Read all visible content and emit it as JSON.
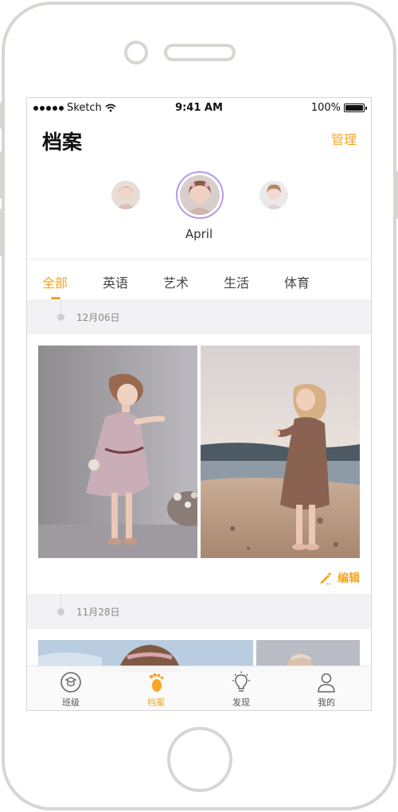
{
  "status_bar": {
    "carrier": "Sketch",
    "time": "9:41 AM",
    "battery": "100%",
    "battery_level": 1.0,
    "signal_icon": "signal-dots-icon",
    "wifi_icon": "wifi-icon",
    "battery_icon": "battery-icon"
  },
  "header": {
    "title": "档案",
    "manage_label": "管理"
  },
  "profiles": {
    "selected_name": "April",
    "avatars": [
      "avatar-left",
      "avatar-selected",
      "avatar-right"
    ]
  },
  "tabs": [
    {
      "label": "全部",
      "active": true
    },
    {
      "label": "英语",
      "active": false
    },
    {
      "label": "艺术",
      "active": false
    },
    {
      "label": "生活",
      "active": false
    },
    {
      "label": "体育",
      "active": false
    }
  ],
  "timeline": [
    {
      "date": "12月06日"
    },
    {
      "date": "11月28日"
    }
  ],
  "post": {
    "edit_label": "编辑",
    "edit_icon": "pencil-icon"
  },
  "bottom_nav": [
    {
      "label": "班级",
      "icon": "class-icon",
      "active": false
    },
    {
      "label": "档案",
      "icon": "footprint-icon",
      "active": true
    },
    {
      "label": "发现",
      "icon": "lightbulb-icon",
      "active": false
    },
    {
      "label": "我的",
      "icon": "person-icon",
      "active": false
    }
  ],
  "colors": {
    "accent": "#f5a623",
    "selected_ring": "#b79be6",
    "strip_bg": "#f2f2f4"
  }
}
